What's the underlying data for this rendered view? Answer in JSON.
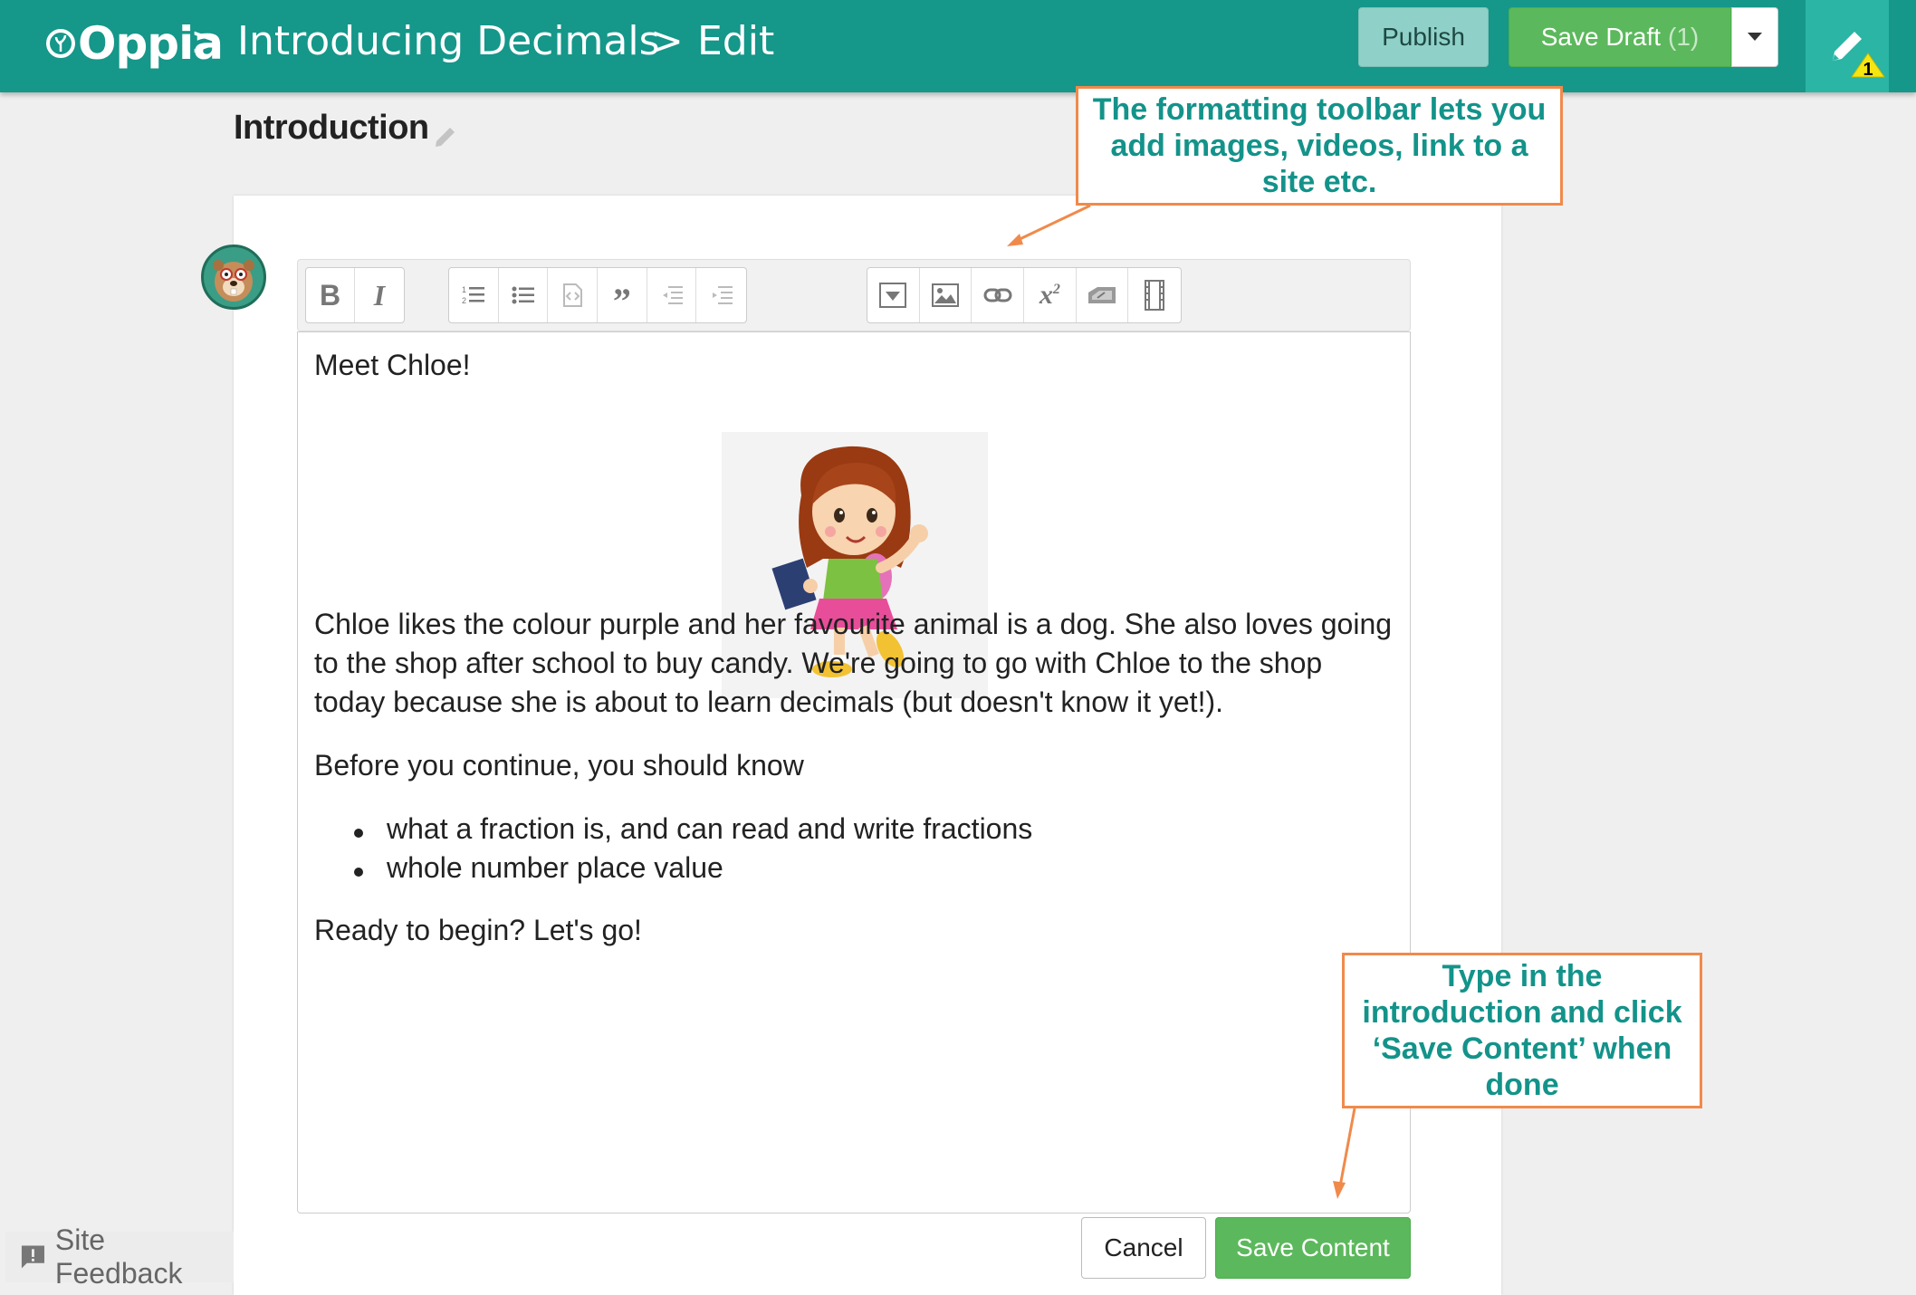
{
  "header": {
    "logo_text": "Oppia",
    "separator": ">",
    "exploration_title": "Introducing Decimals",
    "mode": "Edit",
    "publish_label": "Publish",
    "save_draft_label": "Save Draft",
    "save_draft_count": "(1)",
    "warning_count": "1",
    "colors": {
      "bar": "#15978a",
      "edit_tab": "#2bb5a4",
      "save_green": "#5cb85c"
    }
  },
  "state": {
    "name": "Introduction"
  },
  "toolbar": {
    "groups": [
      [
        "bold-icon",
        "italic-icon"
      ],
      [
        "numbered-list-icon",
        "bulleted-list-icon",
        "code-icon",
        "quote-icon",
        "outdent-icon",
        "indent-icon"
      ],
      [
        "collapsible-icon",
        "image-icon",
        "link-icon",
        "math-icon",
        "tabs-icon",
        "video-icon"
      ]
    ]
  },
  "editor": {
    "greeting": "Meet Chloe!",
    "paragraph_lines": [
      "Chloe likes the colour purple and her favourite animal is a dog. She also loves going",
      "to the shop after school to buy candy. We're going to go with Chloe to the shop",
      "today because she is about to learn decimals (but doesn't know it yet!)."
    ],
    "before_text": "Before you continue, you should know",
    "bullets": [
      "what a fraction is, and can read and write fractions",
      "whole number place value"
    ],
    "closing": "Ready to begin? Let's go!"
  },
  "actions": {
    "cancel_label": "Cancel",
    "save_label": "Save Content"
  },
  "feedback": {
    "label": "Site Feedback"
  },
  "annotations": {
    "toolbar_note": "The formatting toolbar lets you add images, videos, link to a site etc.",
    "save_note": "Type in the introduction and click ‘Save Content’ when done",
    "border_color": "#f08a4b",
    "text_color": "#13938a"
  }
}
